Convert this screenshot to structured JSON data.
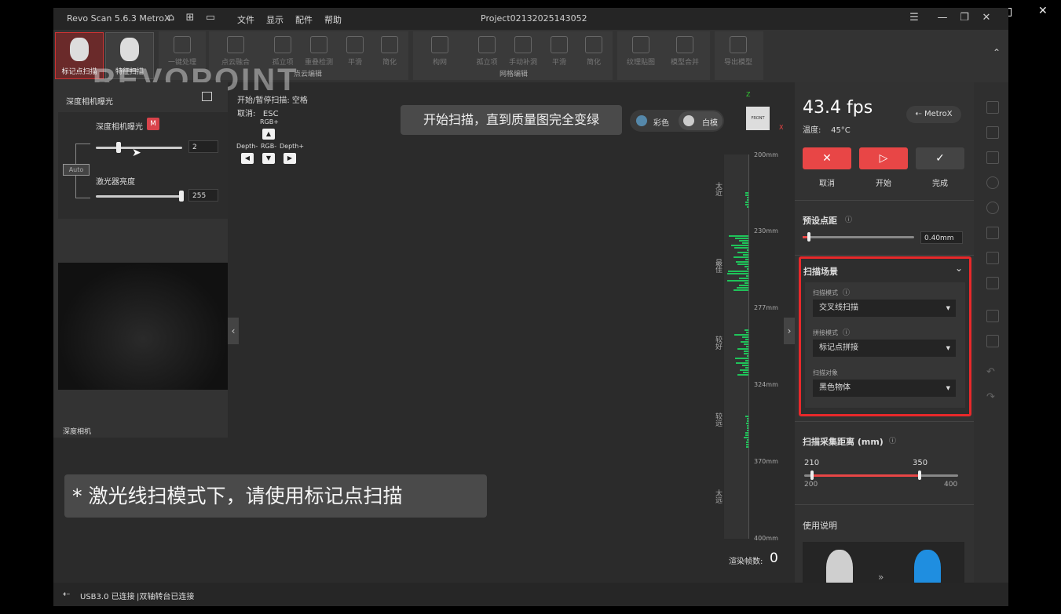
{
  "window": {
    "app_name": "Revo Scan 5.6.3 MetroX",
    "project": "Project02132025143052",
    "menu": [
      "文件",
      "显示",
      "配件",
      "帮助"
    ]
  },
  "toolbar": {
    "scan_buttons": [
      "标记点扫描",
      "特征扫描"
    ],
    "buttons": [
      "一键处理",
      "点云融合",
      "孤立项",
      "重叠检测",
      "平滑",
      "简化",
      "构网",
      "孤立项",
      "手动补洞",
      "平滑",
      "简化",
      "纹理贴图",
      "模型合并",
      "导出模型"
    ],
    "groups": [
      "点云编辑",
      "网格编辑"
    ],
    "logo": "REVOPOINT"
  },
  "left_panel": {
    "title": "深度相机曝光",
    "exposure_label": "深度相机曝光",
    "mode_badge": "M",
    "exposure_value": "2",
    "auto_label": "Auto",
    "laser_label": "激光器亮度",
    "laser_value": "255",
    "camera_label": "深度相机"
  },
  "shortcuts": {
    "start_pause": "开始/暂停扫描: 空格",
    "cancel": "取消:   ESC",
    "rgb_plus": "RGB+",
    "depth_minus": "Depth-",
    "rgb_minus": "RGB-",
    "depth_plus": "Depth+"
  },
  "tip_text": "开始扫描，直到质量图完全变绿",
  "notice_text": "* 激光线扫模式下，请使用标记点扫描",
  "render_toggle": {
    "color": "彩色",
    "white": "白模"
  },
  "view_cube": {
    "front": "FRONT",
    "x": "X",
    "z": "Z"
  },
  "distance_ruler": {
    "ticks": [
      "200mm",
      "230mm",
      "277mm",
      "324mm",
      "370mm",
      "400mm"
    ],
    "zones": [
      "太近",
      "最佳",
      "较好",
      "较远",
      "太远"
    ]
  },
  "render_frames": {
    "label": "渲染帧数:",
    "value": "0"
  },
  "right_panel": {
    "fps": "43.4 fps",
    "temperature": "温度:    45°C",
    "device": "MetroX",
    "buttons": {
      "cancel": "取消",
      "start": "开始",
      "finish": "完成"
    },
    "point_distance": {
      "label": "预设点距",
      "value": "0.40mm"
    },
    "scene": {
      "title": "扫描场景",
      "scan_mode_label": "扫描模式",
      "scan_mode": "交叉线扫描",
      "stitch_label": "拼接模式",
      "stitch_mode": "标记点拼接",
      "target_label": "扫描对象",
      "target": "黑色物体"
    },
    "distance": {
      "label": "扫描采集距离 (mm)",
      "low": "210",
      "high": "350",
      "min": "200",
      "max": "400",
      "low_value": 210,
      "high_value": 350,
      "range_min": 200,
      "range_max": 400
    },
    "instructions_label": "使用说明"
  },
  "status": {
    "usb": "USB3.0 已连接",
    "turntable": "|双轴转台已连接"
  },
  "colors": {
    "accent_red": "#e84646",
    "highlight_green": "#1fc45a",
    "panel_bg": "#2b2b2b"
  }
}
